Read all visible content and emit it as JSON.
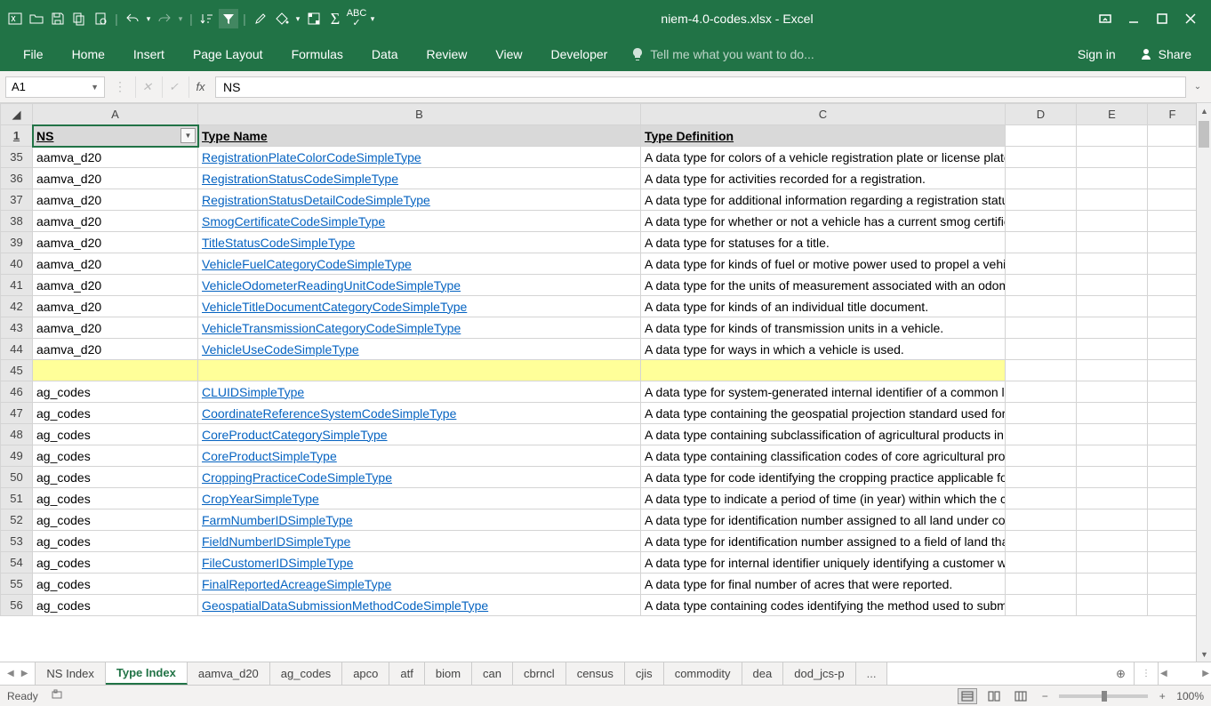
{
  "window": {
    "title": "niem-4.0-codes.xlsx - Excel"
  },
  "ribbon": {
    "file": "File",
    "tabs": [
      "Home",
      "Insert",
      "Page Layout",
      "Formulas",
      "Data",
      "Review",
      "View",
      "Developer"
    ],
    "tellme": "Tell me what you want to do...",
    "signin": "Sign in",
    "share": "Share"
  },
  "formula_bar": {
    "name_box": "A1",
    "formula": "NS"
  },
  "columns": [
    "A",
    "B",
    "C",
    "D",
    "E",
    "F"
  ],
  "header_row_number": "1",
  "headers": {
    "ns": "NS",
    "type_name": "Type Name",
    "type_definition": "Type Definition"
  },
  "rows": [
    {
      "n": "35",
      "ns": "aamva_d20",
      "type": "RegistrationPlateColorCodeSimpleType",
      "def": "A data type for colors of a vehicle registration plate or license plate."
    },
    {
      "n": "36",
      "ns": "aamva_d20",
      "type": "RegistrationStatusCodeSimpleType",
      "def": "A data type for activities recorded for a registration."
    },
    {
      "n": "37",
      "ns": "aamva_d20",
      "type": "RegistrationStatusDetailCodeSimpleType",
      "def": "A data type for additional information regarding a registration status."
    },
    {
      "n": "38",
      "ns": "aamva_d20",
      "type": "SmogCertificateCodeSimpleType",
      "def": "A data type for whether or not a vehicle has a current smog certificate."
    },
    {
      "n": "39",
      "ns": "aamva_d20",
      "type": "TitleStatusCodeSimpleType",
      "def": "A data type for statuses for a title."
    },
    {
      "n": "40",
      "ns": "aamva_d20",
      "type": "VehicleFuelCategoryCodeSimpleType",
      "def": "A data type for kinds of fuel or motive power used to propel a vehicle."
    },
    {
      "n": "41",
      "ns": "aamva_d20",
      "type": "VehicleOdometerReadingUnitCodeSimpleType",
      "def": "A data type for the units of measurement associated with an odometer reading."
    },
    {
      "n": "42",
      "ns": "aamva_d20",
      "type": "VehicleTitleDocumentCategoryCodeSimpleType",
      "def": "A data type for kinds of an individual title document."
    },
    {
      "n": "43",
      "ns": "aamva_d20",
      "type": "VehicleTransmissionCategoryCodeSimpleType",
      "def": "A data type for kinds of transmission units in a vehicle."
    },
    {
      "n": "44",
      "ns": "aamva_d20",
      "type": "VehicleUseCodeSimpleType",
      "def": "A data type for ways in which a vehicle is used."
    },
    {
      "n": "45",
      "sep": true
    },
    {
      "n": "46",
      "ns": "ag_codes",
      "type": "CLUIDSimpleType",
      "def": "A data type for system-generated internal identifier of a common land unit (CLU). Th"
    },
    {
      "n": "47",
      "ns": "ag_codes",
      "type": "CoordinateReferenceSystemCodeSimpleType",
      "def": "A data type containing the geospatial projection standard used for calculating acreag"
    },
    {
      "n": "48",
      "ns": "ag_codes",
      "type": "CoreProductCategorySimpleType",
      "def": "A data type containing subclassification of agricultural products in addition to the ma"
    },
    {
      "n": "49",
      "ns": "ag_codes",
      "type": "CoreProductSimpleType",
      "def": "A data type containing classification codes of core agricultural products defined by th"
    },
    {
      "n": "50",
      "ns": "ag_codes",
      "type": "CroppingPracticeCodeSimpleType",
      "def": "A data type for code identifying the cropping practice applicable for a reported crop/"
    },
    {
      "n": "51",
      "ns": "ag_codes",
      "type": "CropYearSimpleType",
      "def": "A data type to indicate a period of time (in year) within which the crop is normally gro"
    },
    {
      "n": "52",
      "ns": "ag_codes",
      "type": "FarmNumberIDSimpleType",
      "def": "A data type for identification number assigned to all land under control of a particula"
    },
    {
      "n": "53",
      "ns": "ag_codes",
      "type": "FieldNumberIDSimpleType",
      "def": "A data type for identification number assigned to a field of land that is part of a farm"
    },
    {
      "n": "54",
      "ns": "ag_codes",
      "type": "FileCustomerIDSimpleType",
      "def": "A data type for internal identifier uniquely identifying a customer within a specific file"
    },
    {
      "n": "55",
      "ns": "ag_codes",
      "type": "FinalReportedAcreageSimpleType",
      "def": "A data type for final number of acres that were reported."
    },
    {
      "n": "56",
      "ns": "ag_codes",
      "type": "GeospatialDataSubmissionMethodCodeSimpleType",
      "def": "A data type containing codes identifying the method used to submit geospatial data u"
    }
  ],
  "sheet_tabs": [
    "NS Index",
    "Type Index",
    "aamva_d20",
    "ag_codes",
    "apco",
    "atf",
    "biom",
    "can",
    "cbrncl",
    "census",
    "cjis",
    "commodity",
    "dea",
    "dod_jcs-p"
  ],
  "active_sheet_tab": "Type Index",
  "sheet_tabs_more": " ... ",
  "status": {
    "ready": "Ready",
    "zoom": "100%"
  }
}
